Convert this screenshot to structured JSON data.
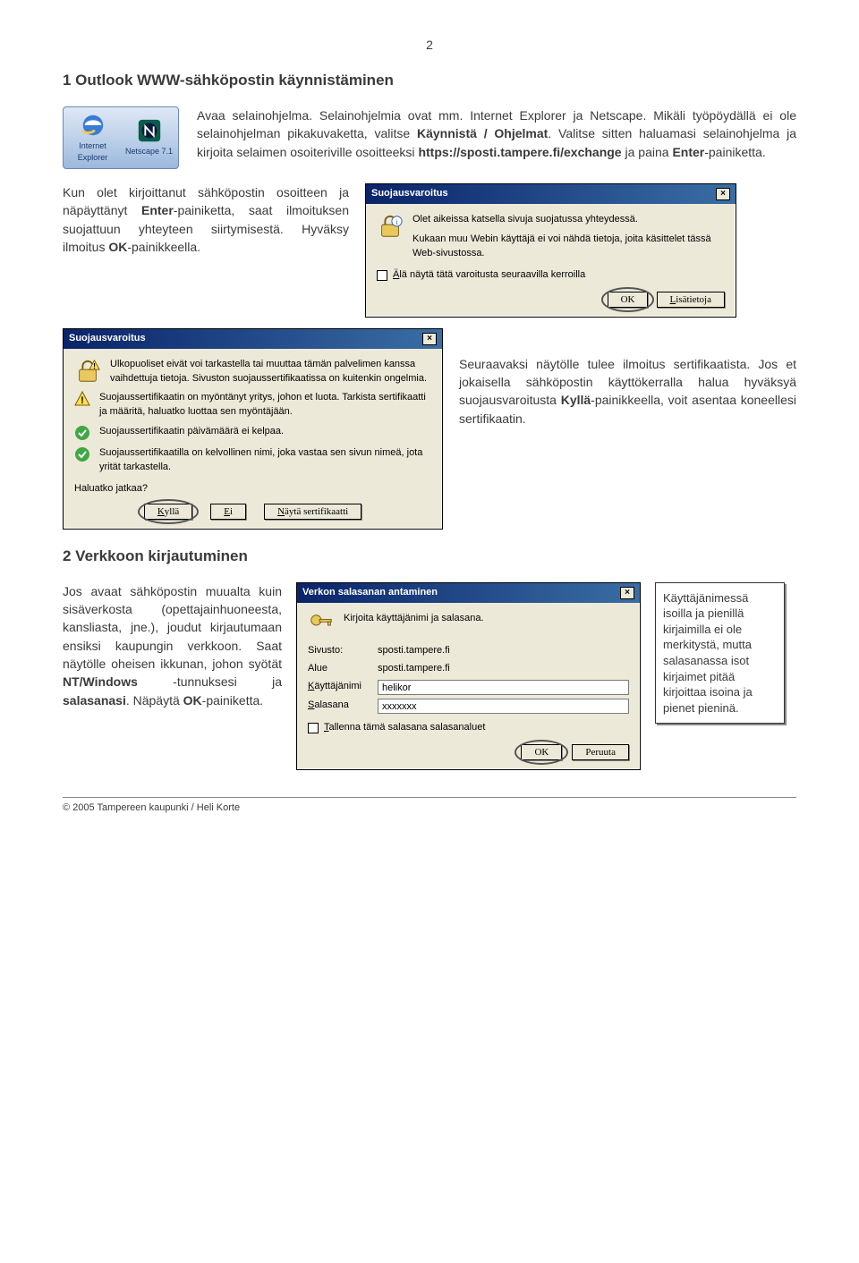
{
  "page_number": "2",
  "section1": {
    "heading": "1 Outlook WWW-sähköpostin käynnistäminen",
    "intro_html": "Avaa selainohjelma. Selainohjelmia ovat mm. Internet Explorer ja Netscape. Mikäli työpöydällä ei ole selainohjelman pikakuvaketta, valitse <b>Käynnistä / Ohjelmat</b>. Valitse sitten haluamasi selainohjelma ja kirjoita selaimen osoiteriville osoitteeksi <b>https://sposti.tampere.fi/exchange</b> ja paina <b>Enter</b>-painiketta.",
    "icons": {
      "ie": "Internet Explorer",
      "netscape": "Netscape 7.1"
    },
    "para_left_html": "Kun olet kirjoittanut sähköpostin osoitteen ja näpäyttänyt <b>Enter</b>-painiketta, saat ilmoituksen suojattuun yhteyteen siirtymisestä. Hyväksy ilmoitus <b>OK</b>-painikkeella.",
    "dlg_secure": {
      "title": "Suojausvaroitus",
      "line1": "Olet aikeissa katsella sivuja suojatussa yhteydessä.",
      "line2": "Kukaan muu Webin käyttäjä ei voi nähdä tietoja, joita käsittelet tässä Web-sivustossa.",
      "checkbox": "Älä näytä tätä varoitusta seuraavilla kerroilla",
      "ok": "OK",
      "more": "Lisätietoja"
    },
    "dlg_cert": {
      "title": "Suojausvaroitus",
      "line1": "Ulkopuoliset eivät voi tarkastella tai muuttaa tämän palvelimen kanssa vaihdettuja tietoja. Sivuston suojaussertifikaatissa on kuitenkin ongelmia.",
      "item_warn": "Suojaussertifikaatin on myöntänyt yritys, johon et luota. Tarkista sertifikaatti ja määritä, haluatko luottaa sen myöntäjään.",
      "item_ok1": "Suojaussertifikaatin päivämäärä ei kelpaa.",
      "item_ok2": "Suojaussertifikaatilla on kelvollinen nimi, joka vastaa sen sivun nimeä, jota yrität tarkastella.",
      "prompt": "Haluatko jatkaa?",
      "yes": "Kyllä",
      "no": "Ei",
      "view": "Näytä sertifikaatti"
    },
    "cert_para_html": "Seuraavaksi näytölle tulee ilmoitus sertifikaatista. Jos et jokaisella sähköpostin käyttökerralla halua hyväksyä suojausvaroitusta <b>Kyllä</b>-painikkeella, voit asentaa koneellesi sertifikaatin."
  },
  "section2": {
    "heading": "2 Verkkoon kirjautuminen",
    "para_html": "Jos avaat sähköpostin muualta kuin sisäverkosta (opettajainhuoneesta, kansliasta, jne.), joudut kirjautumaan ensiksi kaupungin verkkoon. Saat näytölle oheisen ikkunan, johon syötät <b>NT/Windows</b> -tunnuksesi ja <b>salasanasi</b>. Näpäytä <b>OK</b>-painiketta.",
    "dlg_auth": {
      "title": "Verkon salasanan antaminen",
      "prompt": "Kirjoita käyttäjänimi ja salasana.",
      "rows": {
        "site_lbl": "Sivusto:",
        "site_val": "sposti.tampere.fi",
        "realm_lbl": "Alue",
        "realm_val": "sposti.tampere.fi",
        "user_lbl": "Käyttäjänimi",
        "user_val": "helikor",
        "pass_lbl": "Salasana",
        "pass_val": "xxxxxxx"
      },
      "save": "Tallenna tämä salasana salasanaluet",
      "ok": "OK",
      "cancel": "Peruuta"
    },
    "note": "Käyttäjänimessä isoilla ja pienillä kirjaimilla ei ole merkitystä, mutta salasanassa isot kirjaimet pitää kirjoittaa isoina ja pienet pieninä."
  },
  "footer": "© 2005 Tampereen kaupunki / Heli Korte"
}
